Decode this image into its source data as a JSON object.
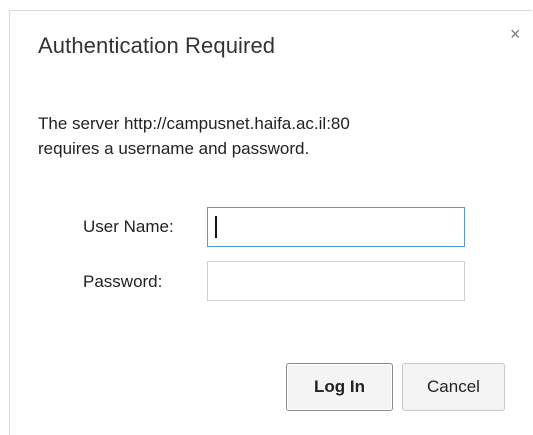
{
  "dialog": {
    "title": "Authentication Required",
    "close_glyph": "×",
    "message_line1": "The server http://campusnet.haifa.ac.il:80",
    "message_line2": "requires a username and password.",
    "username_label": "User Name:",
    "username_value": "",
    "password_label": "Password:",
    "password_value": "",
    "login_label": "Log In",
    "cancel_label": "Cancel"
  },
  "colors": {
    "focus_border": "#5b9bd5",
    "text": "#222222"
  },
  "icons": {
    "close": "close-icon"
  }
}
